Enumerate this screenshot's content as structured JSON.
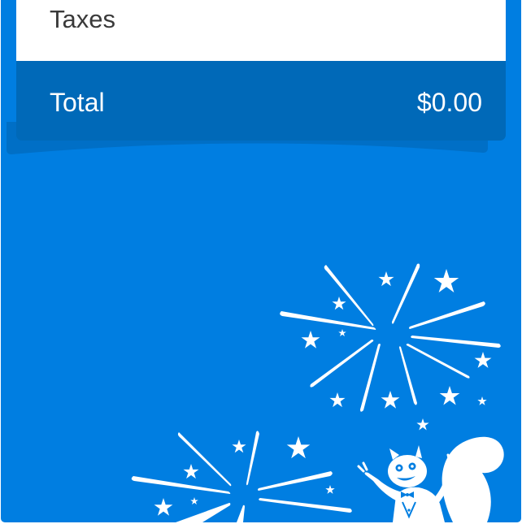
{
  "summary": {
    "taxes_label": "Taxes",
    "total_label": "Total",
    "total_value": "$0.00"
  },
  "colors": {
    "background": "#007ee1",
    "total_bar": "#0069b8",
    "summary_card": "#ffffff",
    "decoration": "#ffffff"
  },
  "decoration": {
    "fireworks_icon": "fireworks-icon",
    "mascot_icon": "squirrel-mascot-icon"
  }
}
